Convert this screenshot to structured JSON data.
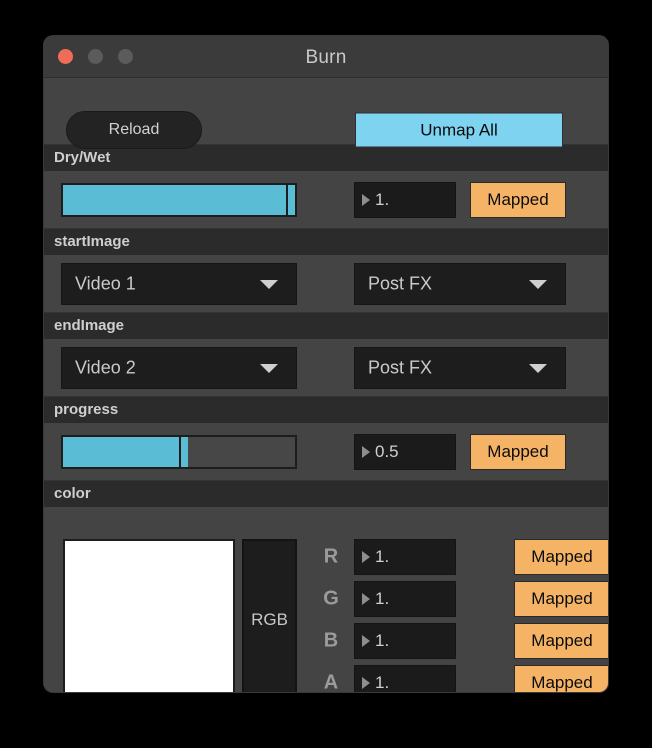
{
  "window": {
    "title": "Burn",
    "traffic_lights": [
      {
        "name": "close",
        "color": "#ee6c58"
      },
      {
        "name": "minimize",
        "color": "#5b5b5b"
      },
      {
        "name": "zoom",
        "color": "#5b5b5b"
      }
    ]
  },
  "toolbar": {
    "reload_label": "Reload",
    "unmap_all_label": "Unmap All",
    "unmap_all_color": "#7dd3f0"
  },
  "theme": {
    "window_bg": "#444444",
    "titlebar_bg": "#3b3b3b",
    "section_header_bg": "#2b2b2b",
    "slider_fill": "#5bbdd5",
    "mapped_color": "#f5b365",
    "field_bg": "#1b1b1b",
    "text_color": "#cfcfcf"
  },
  "sections": [
    {
      "name": "dry-wet",
      "header": "Dry/Wet",
      "type": "slider",
      "slider": {
        "value": 1.0,
        "fill_percent": 96,
        "handle_percent": 96
      },
      "field": {
        "value": "1.",
        "icon": "triangle-right-icon"
      },
      "map_button": {
        "label": "Mapped"
      }
    },
    {
      "name": "start-image",
      "header": "startImage",
      "type": "dropdowns",
      "dropdowns": [
        {
          "name": "source-select",
          "value": "Video 1",
          "icon": "chevron-down-icon"
        },
        {
          "name": "stage-select",
          "value": "Post FX",
          "icon": "chevron-down-icon"
        }
      ]
    },
    {
      "name": "end-image",
      "header": "endImage",
      "type": "dropdowns",
      "dropdowns": [
        {
          "name": "source-select",
          "value": "Video 2",
          "icon": "chevron-down-icon"
        },
        {
          "name": "stage-select",
          "value": "Post FX",
          "icon": "chevron-down-icon"
        }
      ]
    },
    {
      "name": "progress",
      "header": "progress",
      "type": "slider",
      "slider": {
        "value": 0.5,
        "fill_percent": 50,
        "handle_percent": 50
      },
      "field": {
        "value": "0.5",
        "icon": "triangle-right-icon"
      },
      "map_button": {
        "label": "Mapped"
      }
    },
    {
      "name": "color",
      "header": "color",
      "type": "color",
      "swatch": {
        "name": "color-swatch",
        "color": "#ffffff"
      },
      "mode_label": "RGB",
      "channels": [
        {
          "label": "R",
          "value": "1.",
          "map_label": "Mapped",
          "icon": "triangle-right-icon"
        },
        {
          "label": "G",
          "value": "1.",
          "map_label": "Mapped",
          "icon": "triangle-right-icon"
        },
        {
          "label": "B",
          "value": "1.",
          "map_label": "Mapped",
          "icon": "triangle-right-icon"
        },
        {
          "label": "A",
          "value": "1.",
          "map_label": "Mapped",
          "icon": "triangle-right-icon"
        }
      ]
    }
  ]
}
